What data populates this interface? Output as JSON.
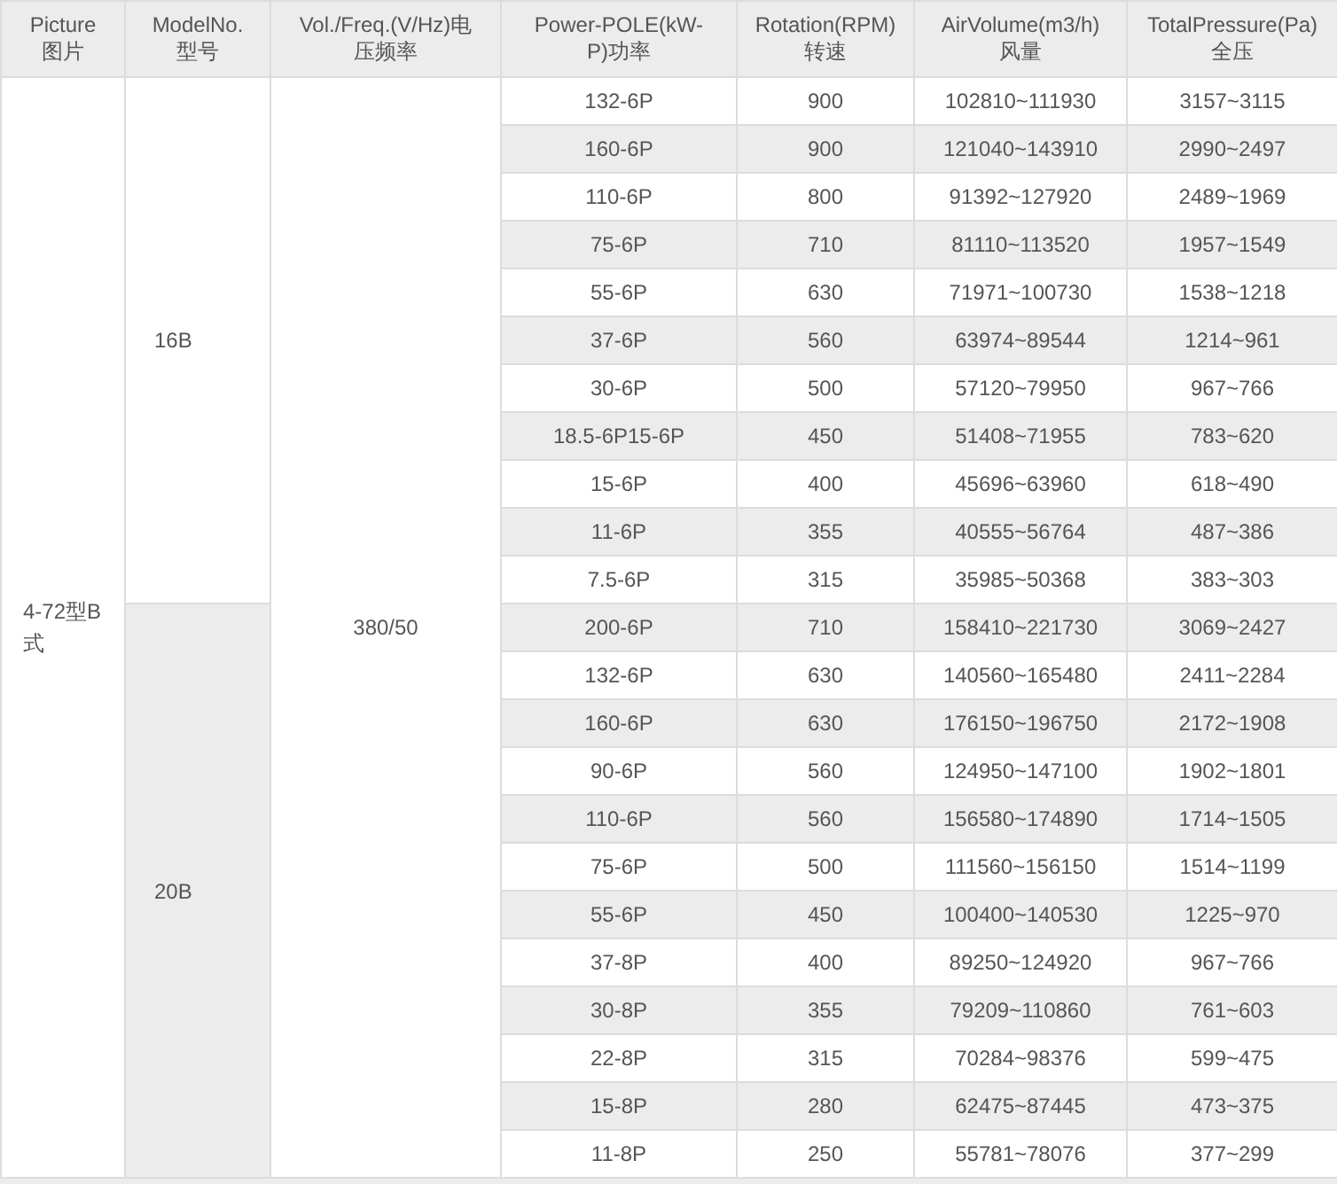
{
  "table": {
    "columns": [
      {
        "lines": [
          "Picture",
          "图片"
        ]
      },
      {
        "lines": [
          "ModelNo.",
          "型号"
        ]
      },
      {
        "lines": [
          "Vol./Freq.(V/Hz)电",
          "压频率"
        ]
      },
      {
        "lines": [
          "Power-POLE(kW-",
          "P)功率"
        ]
      },
      {
        "lines": [
          "Rotation(RPM)",
          "转速"
        ]
      },
      {
        "lines": [
          "AirVolume(m3/h)",
          "风量"
        ]
      },
      {
        "lines": [
          "TotalPressure(Pa)",
          "全压"
        ]
      }
    ],
    "picture_cell": [
      "4-72型B",
      "式"
    ],
    "voltage": "380/50",
    "models": [
      {
        "model": "16B",
        "rows": [
          [
            "132-6P",
            "900",
            "102810~111930",
            "3157~3115"
          ],
          [
            "160-6P",
            "900",
            "121040~143910",
            "2990~2497"
          ],
          [
            "110-6P",
            "800",
            "91392~127920",
            "2489~1969"
          ],
          [
            "75-6P",
            "710",
            "81110~113520",
            "1957~1549"
          ],
          [
            "55-6P",
            "630",
            "71971~100730",
            "1538~1218"
          ],
          [
            "37-6P",
            "560",
            "63974~89544",
            "1214~961"
          ],
          [
            "30-6P",
            "500",
            "57120~79950",
            "967~766"
          ],
          [
            "18.5-6P15-6P",
            "450",
            "51408~71955",
            "783~620"
          ],
          [
            "15-6P",
            "400",
            "45696~63960",
            "618~490"
          ],
          [
            "11-6P",
            "355",
            "40555~56764",
            "487~386"
          ],
          [
            "7.5-6P",
            "315",
            "35985~50368",
            "383~303"
          ]
        ]
      },
      {
        "model": "20B",
        "rows": [
          [
            "200-6P",
            "710",
            "158410~221730",
            "3069~2427"
          ],
          [
            "132-6P",
            "630",
            "140560~165480",
            "2411~2284"
          ],
          [
            "160-6P",
            "630",
            "176150~196750",
            "2172~1908"
          ],
          [
            "90-6P",
            "560",
            "124950~147100",
            "1902~1801"
          ],
          [
            "110-6P",
            "560",
            "156580~174890",
            "1714~1505"
          ],
          [
            "75-6P",
            "500",
            "111560~156150",
            "1514~1199"
          ],
          [
            "55-6P",
            "450",
            "100400~140530",
            "1225~970"
          ],
          [
            "37-8P",
            "400",
            "89250~124920",
            "967~766"
          ],
          [
            "30-8P",
            "355",
            "79209~110860",
            "761~603"
          ],
          [
            "22-8P",
            "315",
            "70284~98376",
            "599~475"
          ],
          [
            "15-8P",
            "280",
            "62475~87445",
            "473~375"
          ],
          [
            "11-8P",
            "250",
            "55781~78076",
            "377~299"
          ]
        ]
      }
    ]
  }
}
